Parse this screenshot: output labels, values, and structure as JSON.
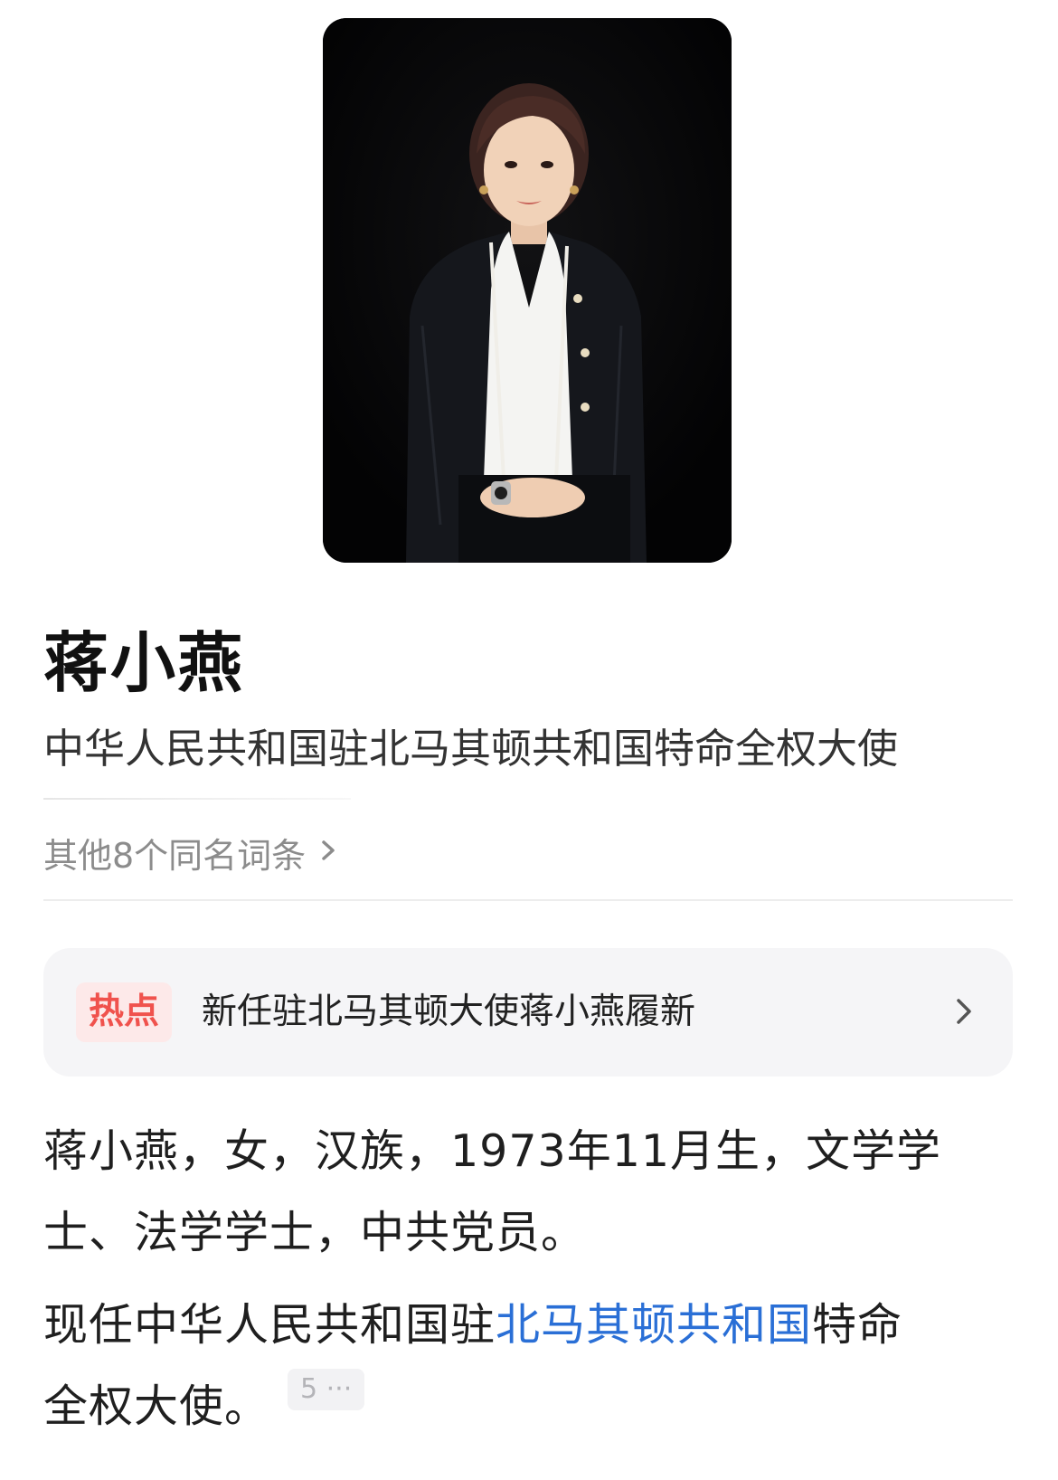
{
  "portrait": {
    "icon": "person-photo",
    "background_color": "#050506"
  },
  "title": {
    "name": "蒋小燕",
    "subtitle": "中华人民共和国驻北马其顿共和国特命全权大使"
  },
  "same_name": {
    "label": "其他8个同名词条",
    "chevron": "›"
  },
  "hot": {
    "badge": "热点",
    "text": "新任驻北马其顿大使蒋小燕履新"
  },
  "intro": {
    "line1": "蒋小燕，女，汉族，1973年11月生，文学学",
    "line2": "士、法学学士，中共党员。"
  },
  "position": {
    "prefix": "现任中华人民共和国驻",
    "link_text": "北马其顿共和国",
    "suffix": "特命",
    "line2": "全权大使。",
    "reference": "5 ···"
  },
  "colors": {
    "link": "#2a6fd6",
    "hot_badge_text": "#f0524d",
    "hot_badge_bg": "#fde9e9",
    "card_bg": "#f5f5f7"
  }
}
